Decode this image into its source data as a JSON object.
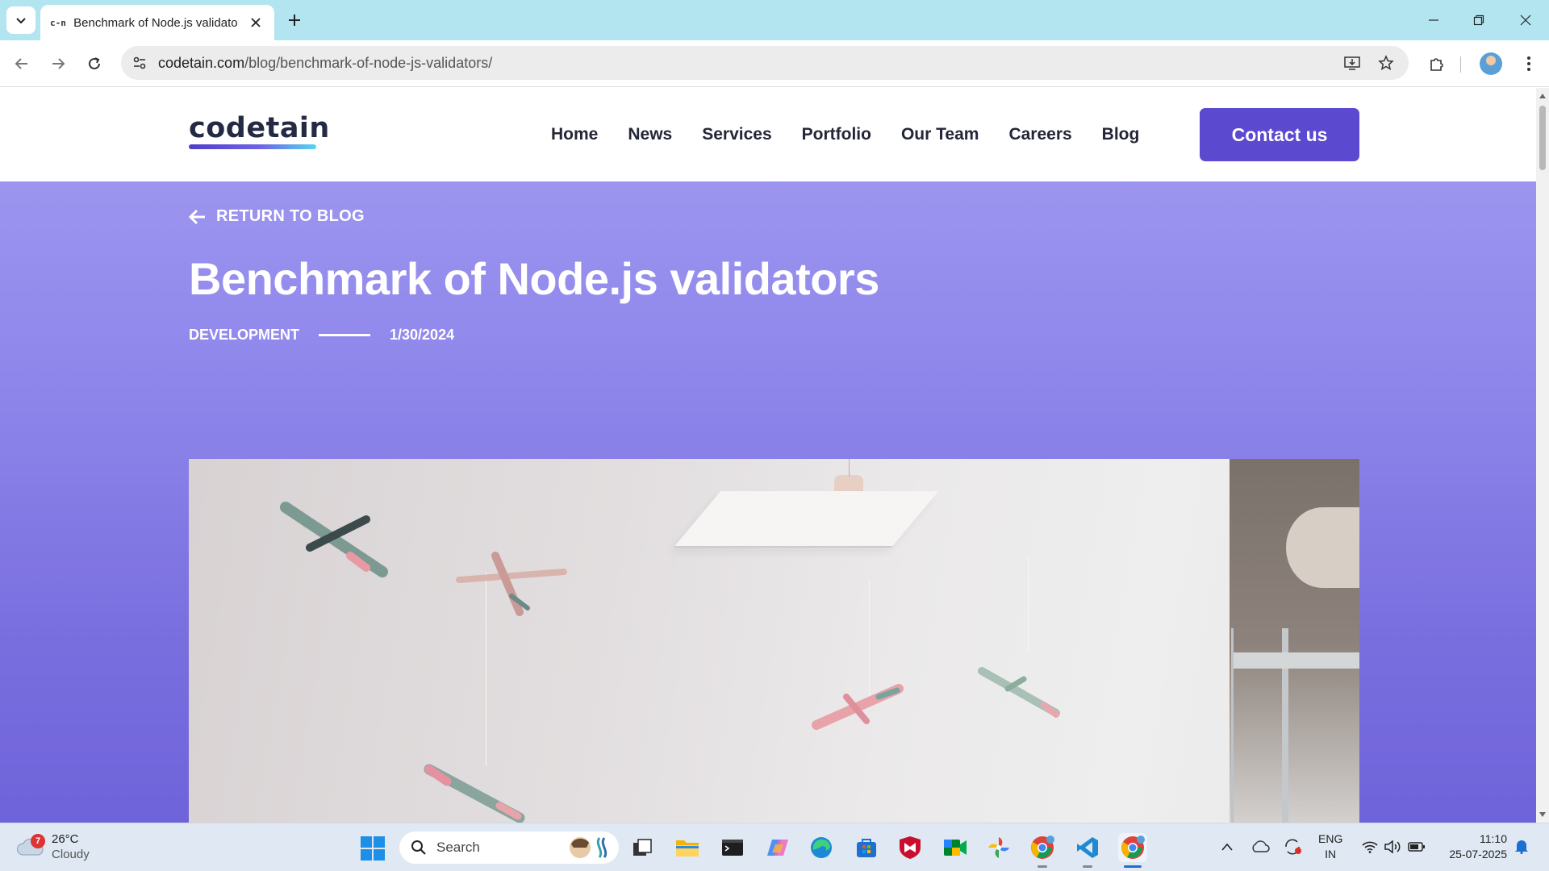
{
  "browser": {
    "tab_title": "Benchmark of Node.js validators",
    "tab_favicon_text": "c-n",
    "url_domain": "codetain.com",
    "url_path": "/blog/benchmark-of-node-js-validators/"
  },
  "site": {
    "logo_text": "codetain",
    "nav": [
      "Home",
      "News",
      "Services",
      "Portfolio",
      "Our Team",
      "Careers",
      "Blog"
    ],
    "contact_label": "Contact us"
  },
  "post": {
    "return_label": "RETURN TO BLOG",
    "title": "Benchmark of Node.js validators",
    "category": "DEVELOPMENT",
    "date": "1/30/2024"
  },
  "taskbar": {
    "weather_temp": "26°C",
    "weather_condition": "Cloudy",
    "weather_badge": "7",
    "search_label": "Search",
    "lang_line1": "ENG",
    "lang_line2": "IN",
    "time": "11:10",
    "date": "25-07-2025"
  },
  "colors": {
    "brand_purple": "#5b49cf",
    "hero_top": "#9c95ef",
    "hero_bottom": "#6f63da",
    "tabbar": "#b3e5f0"
  }
}
